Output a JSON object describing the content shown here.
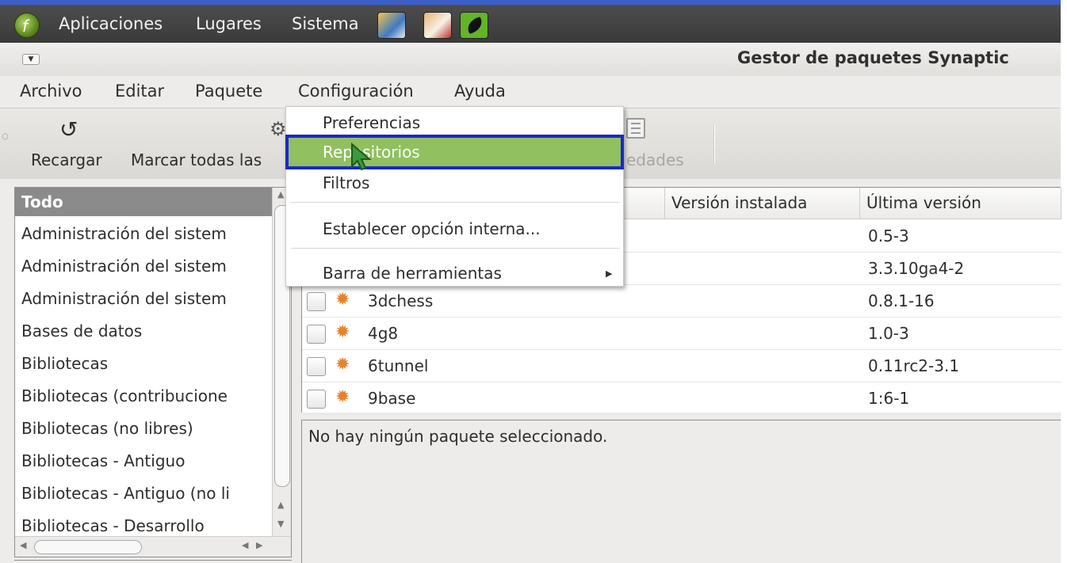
{
  "panel": {
    "applications": "Aplicaciones",
    "places": "Lugares",
    "system": "Sistema"
  },
  "window": {
    "title": "Gestor de paquetes Synaptic"
  },
  "menubar": {
    "file": "Archivo",
    "edit": "Editar",
    "package": "Paquete",
    "settings": "Configuración",
    "help": "Ayuda"
  },
  "toolbar": {
    "reload": "Recargar",
    "mark_all": "Marcar todas las",
    "properties": "edades"
  },
  "settings_menu": {
    "items": [
      "Preferencias",
      "Repositorios",
      "Filtros",
      "Establecer opción interna...",
      "Barra de herramientas"
    ],
    "selected": "Repositorios"
  },
  "categories": {
    "header": "Todo",
    "items": [
      "Administración del sistem",
      "Administración del sistem",
      "Administración del sistem",
      "Bases de datos",
      "Bibliotecas",
      "Bibliotecas (contribucione",
      "Bibliotecas (no libres)",
      "Bibliotecas - Antiguo",
      "Bibliotecas - Antiguo (no li",
      "Bibliotecas - Desarrollo"
    ]
  },
  "packages": {
    "columns": {
      "installed": "Versión instalada",
      "latest": "Última versión"
    },
    "rows": [
      {
        "name": "",
        "installed": "",
        "latest": "0.5-3"
      },
      {
        "name": "",
        "installed": "",
        "latest": "3.3.10ga4-2"
      },
      {
        "name": "3dchess",
        "installed": "",
        "latest": "0.8.1-16"
      },
      {
        "name": "4g8",
        "installed": "",
        "latest": "1.0-3"
      },
      {
        "name": "6tunnel",
        "installed": "",
        "latest": "0.11rc2-3.1"
      },
      {
        "name": "9base",
        "installed": "",
        "latest": "1:6-1"
      }
    ]
  },
  "description": {
    "text": "No hay ningún paquete seleccionado."
  },
  "colors": {
    "highlight_border": "#1b28c9",
    "selected_item": "#90c060",
    "package_icon": "#e8822a"
  }
}
